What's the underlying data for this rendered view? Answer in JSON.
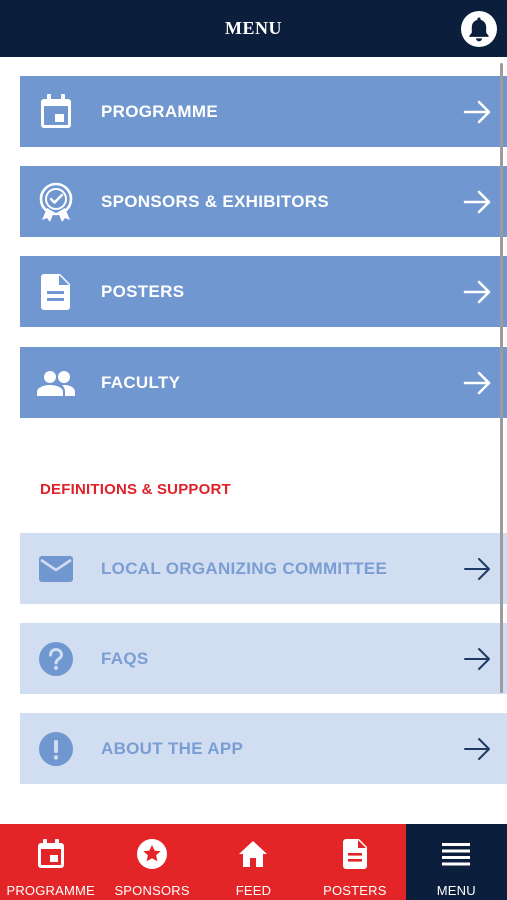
{
  "header": {
    "title": "MENU",
    "bell_icon": "bell-icon"
  },
  "menu": {
    "main_items": [
      {
        "label": "PROGRAMME",
        "icon": "calendar-icon"
      },
      {
        "label": "SPONSORS & EXHIBITORS",
        "icon": "award-ribbon-icon"
      },
      {
        "label": "POSTERS",
        "icon": "document-icon"
      },
      {
        "label": "FACULTY",
        "icon": "people-icon"
      }
    ],
    "section_title": "DEFINITIONS & SUPPORT",
    "support_items": [
      {
        "label": "LOCAL ORGANIZING COMMITTEE",
        "icon": "envelope-icon"
      },
      {
        "label": "FAQS",
        "icon": "question-circle-icon"
      },
      {
        "label": "ABOUT THE APP",
        "icon": "info-exclamation-icon"
      }
    ]
  },
  "tabbar": {
    "tabs": [
      {
        "label": "PROGRAMME",
        "icon": "calendar-icon",
        "active": false
      },
      {
        "label": "SPONSORS",
        "icon": "star-circle-icon",
        "active": false
      },
      {
        "label": "FEED",
        "icon": "home-icon",
        "active": false
      },
      {
        "label": "POSTERS",
        "icon": "document-icon",
        "active": false
      },
      {
        "label": "MENU",
        "icon": "hamburger-icon",
        "active": true
      }
    ]
  },
  "colors": {
    "header_bg": "#0b1f3d",
    "primary_item_bg": "#7097cf",
    "secondary_item_bg": "#d1ddf0",
    "secondary_text": "#7a9ed3",
    "section_title": "#e0202a",
    "tabbar_bg": "#e42527",
    "tabbar_active_bg": "#0b1f3d"
  }
}
